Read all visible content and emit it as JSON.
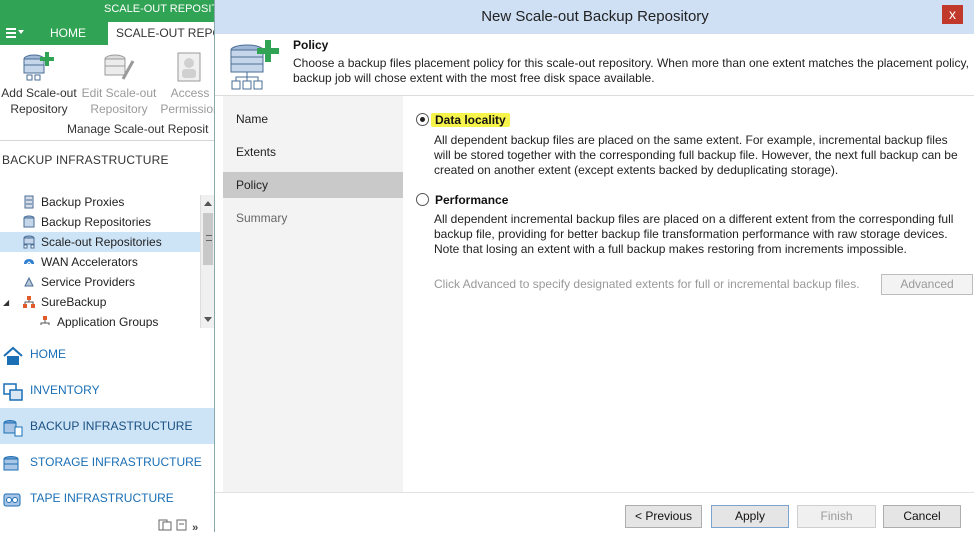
{
  "app": {
    "window_title": "SCALE-OUT REPOSITO",
    "tabs": [
      "HOME",
      "SCALE-OUT REPO"
    ],
    "ribbon": {
      "buttons": [
        {
          "line1": "Add Scale-out",
          "line2": "Repository"
        },
        {
          "line1": "Edit Scale-out",
          "line2": "Repository"
        },
        {
          "line1": "Access",
          "line2": "Permission"
        }
      ],
      "group_label": "Manage  Scale-out Reposit"
    },
    "nav_title": "BACKUP INFRASTRUCTURE",
    "tree": [
      {
        "label": "Backup Proxies",
        "icon": "server-icon"
      },
      {
        "label": "Backup Repositories",
        "icon": "repository-icon"
      },
      {
        "label": "Scale-out Repositories",
        "icon": "scaleout-repository-icon"
      },
      {
        "label": "WAN Accelerators",
        "icon": "wan-accelerator-icon"
      },
      {
        "label": "Service Providers",
        "icon": "cloud-provider-icon"
      },
      {
        "label": "SureBackup",
        "icon": "surebackup-icon"
      },
      {
        "label": "Application Groups",
        "icon": "application-group-icon"
      }
    ],
    "nav_sections": [
      {
        "label": "HOME",
        "icon": "home-icon"
      },
      {
        "label": "INVENTORY",
        "icon": "inventory-icon"
      },
      {
        "label": "BACKUP INFRASTRUCTURE",
        "icon": "backup-infrastructure-icon"
      },
      {
        "label": "STORAGE INFRASTRUCTURE",
        "icon": "storage-icon"
      },
      {
        "label": "TAPE INFRASTRUCTURE",
        "icon": "tape-icon"
      }
    ],
    "bottom_more": "»"
  },
  "dialog": {
    "title": "New Scale-out Backup Repository",
    "close": "x",
    "header": {
      "title": "Policy",
      "description": "Choose a backup files placement policy for this scale-out repository. When more than one extent matches the placement policy, backup job will chose extent with the most free disk space available."
    },
    "steps": [
      "Name",
      "Extents",
      "Policy",
      "Summary"
    ],
    "active_step": "Policy",
    "options": {
      "data_locality": {
        "label": "Data locality",
        "selected": true,
        "description": "All dependent backup files are placed on the same extent. For example, incremental backup files will be stored together with the corresponding full backup file. However, the next full backup can be created on another extent (except extents backed by deduplicating storage)."
      },
      "performance": {
        "label": "Performance",
        "selected": false,
        "description": "All dependent incremental backup files are placed on a different extent from the corresponding full backup file, providing for better backup file transformation performance with raw storage devices. Note that losing an extent with a full backup makes restoring from increments impossible."
      }
    },
    "advanced_hint": "Click Advanced to specify designated extents for full or incremental backup files.",
    "advanced_button": "Advanced",
    "buttons": {
      "previous": "< Previous",
      "apply": "Apply",
      "finish": "Finish",
      "cancel": "Cancel"
    }
  },
  "colors": {
    "veeam_green": "#31a354",
    "title_bar": "#cfe0f5",
    "selection": "#cde4f7",
    "highlight": "#f6f34a",
    "nav_text": "#1a6fb5"
  }
}
